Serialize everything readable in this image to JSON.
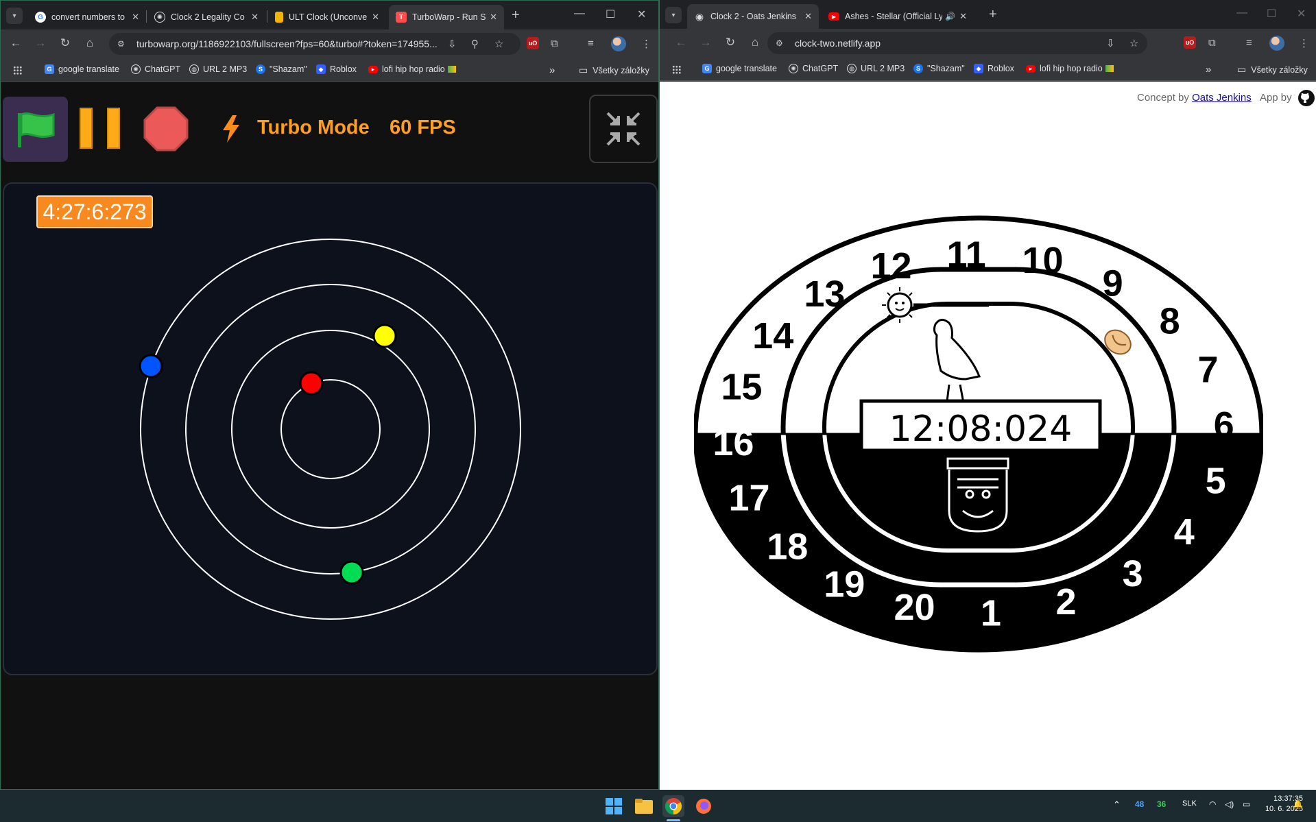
{
  "left_window": {
    "tabs": [
      {
        "title": "convert numbers to",
        "favicon": "google-icon"
      },
      {
        "title": "Clock 2 Legality Co",
        "favicon": "chatgpt-icon"
      },
      {
        "title": "ULT Clock (Unconve",
        "favicon": "doc-icon"
      },
      {
        "title": "TurboWarp - Run S",
        "favicon": "turbowarp-icon",
        "active": true
      }
    ],
    "url": "turbowarp.org/1186922103/fullscreen?fps=60&turbo#?token=174955...",
    "turbowarp": {
      "turbo_label": "Turbo Mode",
      "fps_label": "60 FPS",
      "timer": "4:27:6:273",
      "dot_colors": [
        "#ff0000",
        "#ffff00",
        "#00dd55",
        "#0055ff"
      ]
    }
  },
  "right_window": {
    "tabs": [
      {
        "title": "Clock 2 - Oats Jenkins",
        "favicon": "eye-icon",
        "active": true
      },
      {
        "title": "Ashes - Stellar (Official Lyric",
        "favicon": "youtube-icon"
      }
    ],
    "url": "clock-two.netlify.app",
    "credit": {
      "concept_prefix": "Concept by",
      "concept_link": "Oats Jenkins",
      "app_prefix": "App by"
    },
    "clock": {
      "time": "12:08:024",
      "numbers": [
        "1",
        "2",
        "3",
        "4",
        "5",
        "6",
        "7",
        "8",
        "9",
        "10",
        "11",
        "12",
        "13",
        "14",
        "15",
        "16",
        "17",
        "18",
        "19",
        "20"
      ]
    }
  },
  "bookmarks": [
    {
      "label": "google translate",
      "icon": "translate-icon"
    },
    {
      "label": "ChatGPT",
      "icon": "chatgpt-icon"
    },
    {
      "label": "URL 2 MP3",
      "icon": "globe-icon"
    },
    {
      "label": "\"Shazam\"",
      "icon": "shazam-icon"
    },
    {
      "label": "Roblox",
      "icon": "roblox-icon"
    },
    {
      "label": "lofi hip hop radio",
      "icon": "youtube-icon"
    }
  ],
  "all_bookmarks_label": "Všetky záložky",
  "taskbar": {
    "tray_num1": "48",
    "tray_num2": "36",
    "language": "SLK",
    "time": "13:37:35",
    "date": "10. 6. 2025"
  }
}
